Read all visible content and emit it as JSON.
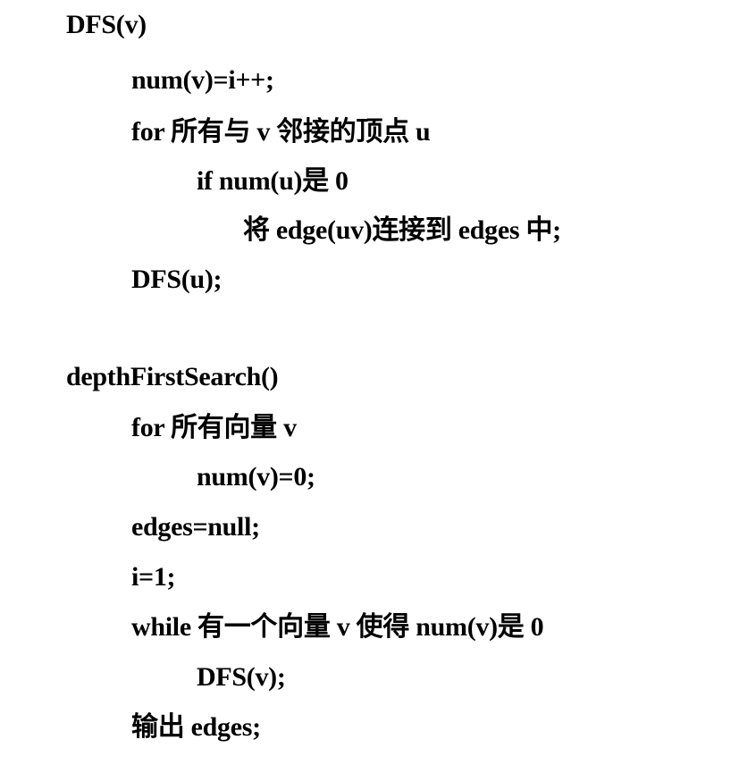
{
  "procedures": {
    "dfs": {
      "signature": "DFS(v)",
      "lines": [
        "num(v)=i++;",
        "for 所有与 v 邻接的顶点 u",
        "if num(u)是 0",
        "将 edge(uv)连接到 edges 中;",
        "DFS(u);"
      ]
    },
    "depth_first_search": {
      "signature": "depthFirstSearch()",
      "lines": [
        "for 所有向量 v",
        "num(v)=0;",
        "edges=null;",
        "i=1;",
        "while 有一个向量 v 使得 num(v)是 0",
        "DFS(v);",
        "输出 edges;"
      ]
    }
  }
}
